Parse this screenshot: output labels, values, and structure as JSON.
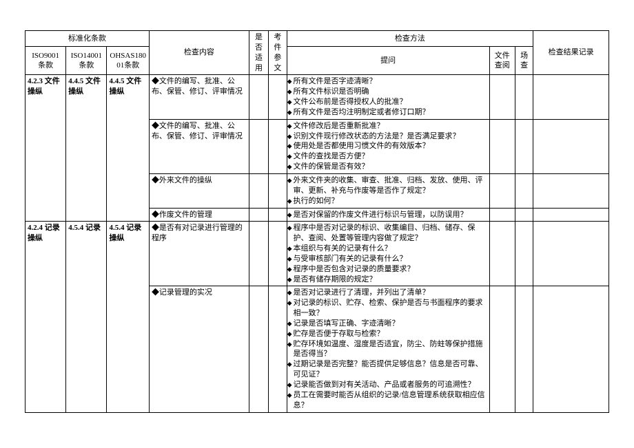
{
  "headers": {
    "std_group": "标准化条款",
    "iso9001": "ISO9001 条款",
    "iso14001": "ISO14001 条款",
    "ohsas": "OHSAS18001条款",
    "content": "检查内容",
    "applicable": "是否适用",
    "ref": "考件参文",
    "method_group": "检查方法",
    "question": "提问",
    "doc_review": "文件查阅",
    "site_check": "场查",
    "result": "检查结果记录"
  },
  "rows": [
    {
      "iso9001": "4.2.3 文件操纵",
      "iso14001": "4.4.5 文件操纵",
      "ohsas": "4.4.5 文件操纵",
      "content": "◆文件的编写、批准、公布、保管、修订、评审情况",
      "questions": [
        "所有文件是否字迹清晰？",
        "所有文件标识是否明确",
        "文件公布前是否得授权人的批准？",
        "所有文件是否均注明制定或者修订口期？"
      ],
      "span9001": 4,
      "span14001": 4,
      "spanohsas": 4
    },
    {
      "content": "◆文件的编写、批准、公布、保管、修订、评审情况",
      "questions": [
        "文件修改后是否重新批准？",
        "识别文件现行修改状态的方法是？是否满足要求？",
        "使用处是否都使用习惯文件的有效版本？",
        "文件的查找是否方便？",
        "文件的保管是否有效？"
      ]
    },
    {
      "content": "◆外来文件的操纵",
      "questions": [
        "外来文件夹的收集、审查、批准、归档、发放、使用、评审、更新、补充与作废等是否作了规定？",
        "执行的如何？"
      ]
    },
    {
      "content": "◆作废文件的管理",
      "questions": [
        "是否对保留的作废文件进行标识与管理，以防误用？"
      ]
    },
    {
      "iso9001": "4.2.4 记录操纵",
      "iso14001": "4.5.4 记录",
      "ohsas": "4.5.4 记录操纵",
      "content": "◆是否有对记录进行管理的程序",
      "questions": [
        "程序中是否对记录的标识、收集编目、归档、储存、保护、查阅、处置等管理内容做了规定？",
        "本组织与有关的记录有什么？",
        "与受审核部门有关的记录有什么？",
        "程序中是否包含对记录的质量要求？",
        "是否有储存期限的规定？"
      ],
      "span9001": 2,
      "span14001": 2,
      "spanohsas": 2
    },
    {
      "content": "◆记录管理的实况",
      "questions": [
        "是否对记录进行了清理，并列出了清单？",
        "对记录的标识、贮存、检索、保护是否与书面程序的要求相一致？",
        "记录是否填写正确、字迹清晰？",
        "贮存是否便于存取与检索？",
        "贮存环境如温度、湿度是否适宜，防尘、防蛀等保护措施是否得当？",
        "过期记录是否完整？能否提供足够信息？信息是否可靠、可见证？",
        "记录能否做到对有关活动、产品或者服务的可追溯性？",
        "员工在需要时能否从组织的记录/信息管理系统获取相应信息？"
      ]
    }
  ]
}
